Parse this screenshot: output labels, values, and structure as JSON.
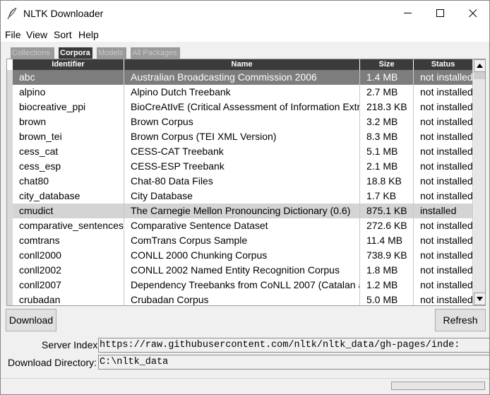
{
  "window": {
    "title": "NLTK Downloader"
  },
  "menu": [
    "File",
    "View",
    "Sort",
    "Help"
  ],
  "tabs": [
    {
      "label": "Collections",
      "active": false
    },
    {
      "label": "Corpora",
      "active": true
    },
    {
      "label": "Models",
      "active": false
    },
    {
      "label": "All Packages",
      "active": false
    }
  ],
  "columns": [
    "Identifier",
    "Name",
    "Size",
    "Status"
  ],
  "rows": [
    {
      "id": "abc",
      "name": "Australian Broadcasting Commission 2006",
      "size": "1.4 MB",
      "status": "not installed",
      "state": "selected"
    },
    {
      "id": "alpino",
      "name": "Alpino Dutch Treebank",
      "size": "2.7 MB",
      "status": "not installed",
      "state": "normal"
    },
    {
      "id": "biocreative_ppi",
      "name": "BioCreAtIvE (Critical Assessment of Information Extra",
      "size": "218.3 KB",
      "status": "not installed",
      "state": "normal"
    },
    {
      "id": "brown",
      "name": "Brown Corpus",
      "size": "3.2 MB",
      "status": "not installed",
      "state": "normal"
    },
    {
      "id": "brown_tei",
      "name": "Brown Corpus (TEI XML Version)",
      "size": "8.3 MB",
      "status": "not installed",
      "state": "normal"
    },
    {
      "id": "cess_cat",
      "name": "CESS-CAT Treebank",
      "size": "5.1 MB",
      "status": "not installed",
      "state": "normal"
    },
    {
      "id": "cess_esp",
      "name": "CESS-ESP Treebank",
      "size": "2.1 MB",
      "status": "not installed",
      "state": "normal"
    },
    {
      "id": "chat80",
      "name": "Chat-80 Data Files",
      "size": "18.8 KB",
      "status": "not installed",
      "state": "normal"
    },
    {
      "id": "city_database",
      "name": "City Database",
      "size": "1.7 KB",
      "status": "not installed",
      "state": "normal"
    },
    {
      "id": "cmudict",
      "name": "The Carnegie Mellon Pronouncing Dictionary (0.6)",
      "size": "875.1 KB",
      "status": "installed",
      "state": "installed"
    },
    {
      "id": "comparative_sentences",
      "name": "Comparative Sentence Dataset",
      "size": "272.6 KB",
      "status": "not installed",
      "state": "normal"
    },
    {
      "id": "comtrans",
      "name": "ComTrans Corpus Sample",
      "size": "11.4 MB",
      "status": "not installed",
      "state": "normal"
    },
    {
      "id": "conll2000",
      "name": "CONLL 2000 Chunking Corpus",
      "size": "738.9 KB",
      "status": "not installed",
      "state": "normal"
    },
    {
      "id": "conll2002",
      "name": "CONLL 2002 Named Entity Recognition Corpus",
      "size": "1.8 MB",
      "status": "not installed",
      "state": "normal"
    },
    {
      "id": "conll2007",
      "name": "Dependency Treebanks from CoNLL 2007 (Catalan a",
      "size": "1.2 MB",
      "status": "not installed",
      "state": "normal"
    },
    {
      "id": "crubadan",
      "name": "Crubadan Corpus",
      "size": "5.0 MB",
      "status": "not installed",
      "state": "normal"
    }
  ],
  "buttons": {
    "download": "Download",
    "refresh": "Refresh"
  },
  "server_index": {
    "label": "Server Index:",
    "value": "https://raw.githubusercontent.com/nltk/nltk_data/gh-pages/inde:"
  },
  "download_dir": {
    "label": "Download Directory:",
    "value": "C:\\nltk_data"
  },
  "progress": {
    "fraction": 0
  },
  "colors": {
    "header_bg": "#3b3b3b",
    "selected_row": "#7d7d7d",
    "installed_row": "#d4d4d4",
    "progress_fill": "#06b025"
  },
  "icons": [
    "feather-icon",
    "minimize-icon",
    "maximize-icon",
    "close-icon",
    "scroll-up-arrow-icon",
    "scroll-down-arrow-icon"
  ]
}
